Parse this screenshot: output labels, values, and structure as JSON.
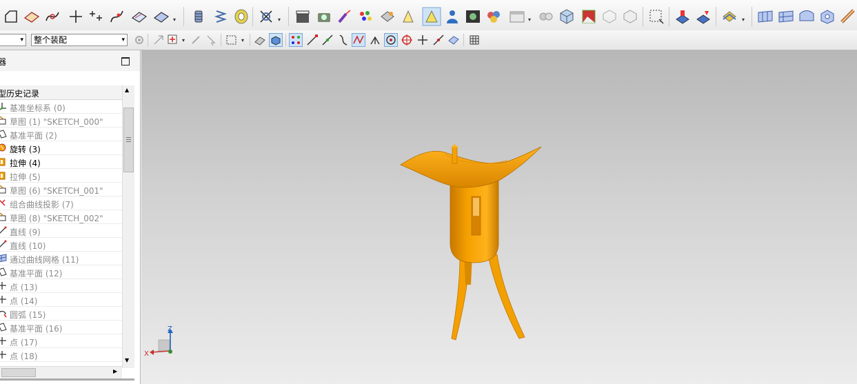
{
  "toolbar": {
    "filter_value": "",
    "assembly_select": "整个装配",
    "dropdown_arrow": "▾"
  },
  "panel": {
    "title": "器",
    "history_header": "型历史记录"
  },
  "tree": {
    "items": [
      {
        "label": "基准坐标系 (0)",
        "icon": "datum-csys-icon",
        "grey": true
      },
      {
        "label": "草图 (1) \"SKETCH_000\"",
        "icon": "sketch-icon",
        "grey": true
      },
      {
        "label": "基准平面 (2)",
        "icon": "datum-plane-icon",
        "grey": true
      },
      {
        "label": "旋转 (3)",
        "icon": "revolve-icon",
        "grey": false
      },
      {
        "label": "拉伸 (4)",
        "icon": "extrude-icon",
        "grey": false
      },
      {
        "label": "拉伸 (5)",
        "icon": "extrude-icon",
        "grey": true
      },
      {
        "label": "草图 (6) \"SKETCH_001\"",
        "icon": "sketch-icon",
        "grey": true
      },
      {
        "label": "组合曲线投影 (7)",
        "icon": "combined-projection-icon",
        "grey": true
      },
      {
        "label": "草图 (8) \"SKETCH_002\"",
        "icon": "sketch-icon",
        "grey": true
      },
      {
        "label": "直线 (9)",
        "icon": "line-icon",
        "grey": true
      },
      {
        "label": "直线 (10)",
        "icon": "line-icon",
        "grey": true
      },
      {
        "label": "通过曲线网格 (11)",
        "icon": "curve-mesh-icon",
        "grey": true
      },
      {
        "label": "基准平面 (12)",
        "icon": "datum-plane-icon",
        "grey": true
      },
      {
        "label": "点 (13)",
        "icon": "point-icon",
        "grey": true
      },
      {
        "label": "点 (14)",
        "icon": "point-icon",
        "grey": true
      },
      {
        "label": "圆弧 (15)",
        "icon": "arc-icon",
        "grey": true
      },
      {
        "label": "基准平面 (16)",
        "icon": "datum-plane-icon",
        "grey": true
      },
      {
        "label": "点 (17)",
        "icon": "point-icon",
        "grey": true
      },
      {
        "label": "点 (18)",
        "icon": "point-icon",
        "grey": true
      }
    ]
  },
  "triad": {
    "z_label": "Z",
    "x_label": "X"
  },
  "colors": {
    "model": "#f5a000",
    "model_dark": "#c87800",
    "accent": "#1f5fbf"
  }
}
